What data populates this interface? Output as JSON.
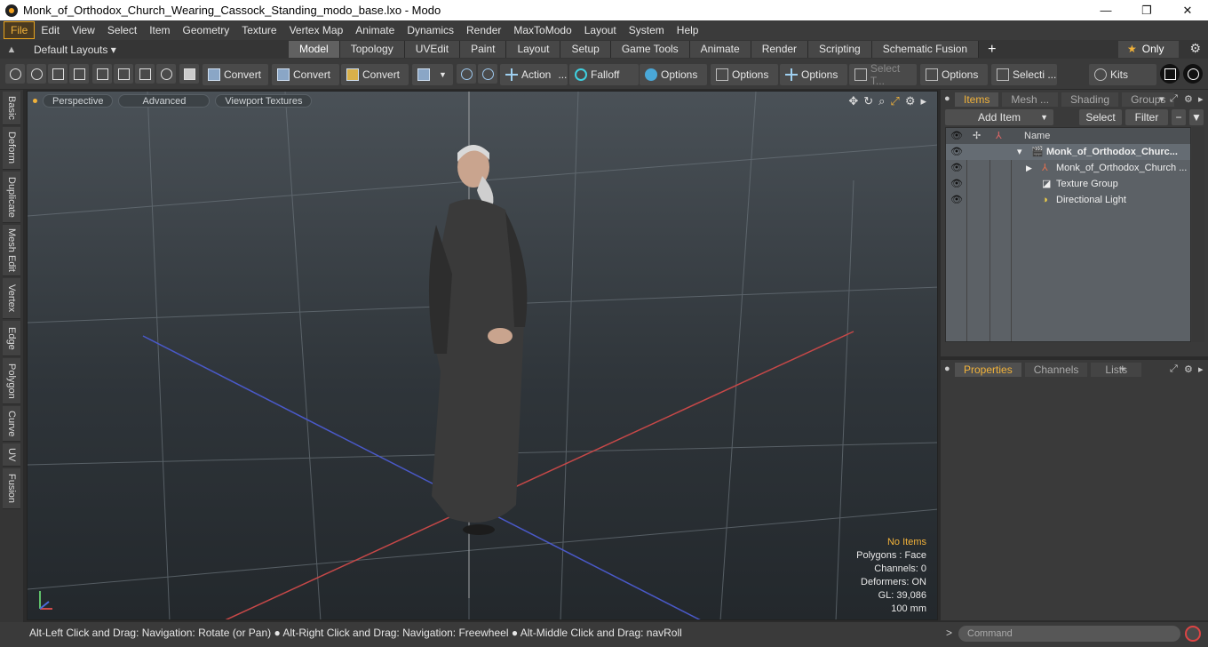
{
  "window": {
    "title": "Monk_of_Orthodox_Church_Wearing_Cassock_Standing_modo_base.lxo - Modo",
    "controls": [
      "—",
      "❐",
      "✕"
    ]
  },
  "menu": [
    "File",
    "Edit",
    "View",
    "Select",
    "Item",
    "Geometry",
    "Texture",
    "Vertex Map",
    "Animate",
    "Dynamics",
    "Render",
    "MaxToModo",
    "Layout",
    "System",
    "Help"
  ],
  "layouts_label": "Default Layouts ▾",
  "tabs": [
    "Model",
    "Topology",
    "UVEdit",
    "Paint",
    "Layout",
    "Setup",
    "Game Tools",
    "Animate",
    "Render",
    "Scripting",
    "Schematic Fusion"
  ],
  "active_tab": "Model",
  "only_label": "Only",
  "toolbar": {
    "convert1": "Convert",
    "convert2": "Convert",
    "convert3": "Convert",
    "action": "Action",
    "falloff": "Falloff",
    "options1": "Options",
    "options2": "Options",
    "options3": "Options",
    "select_t": "Select T...",
    "options4": "Options",
    "selecti": "Selecti ...",
    "kits": "Kits"
  },
  "left_tabs": [
    "Basic",
    "Deform",
    "Duplicate",
    "Mesh Edit",
    "Vertex",
    "Edge",
    "Polygon",
    "Curve",
    "UV",
    "Fusion"
  ],
  "viewport": {
    "perspective": "Perspective",
    "advanced": "Advanced",
    "textures": "Viewport Textures",
    "info": {
      "no_items": "No Items",
      "polygons": "Polygons : Face",
      "channels": "Channels: 0",
      "deformers": "Deformers: ON",
      "gl": "GL: 39,086",
      "scale": "100 mm"
    }
  },
  "items_panel": {
    "tabs": [
      "Items",
      "Mesh ...",
      "Shading",
      "Groups"
    ],
    "add_item": "Add Item",
    "select": "Select",
    "filter": "Filter",
    "name_header": "Name",
    "rows": [
      {
        "label": "Monk_of_Orthodox_Churc..."
      },
      {
        "label": "Monk_of_Orthodox_Church ..."
      },
      {
        "label": "Texture Group"
      },
      {
        "label": "Directional Light"
      }
    ]
  },
  "properties_panel": {
    "tabs": [
      "Properties",
      "Channels",
      "Lists"
    ]
  },
  "status_text": "Alt-Left Click and Drag: Navigation: Rotate (or Pan) ● Alt-Right Click and Drag: Navigation: Freewheel ● Alt-Middle Click and Drag: navRoll",
  "command_placeholder": "Command",
  "colors": {
    "accent": "#f1b23a",
    "panel": "#3a3a3a"
  }
}
